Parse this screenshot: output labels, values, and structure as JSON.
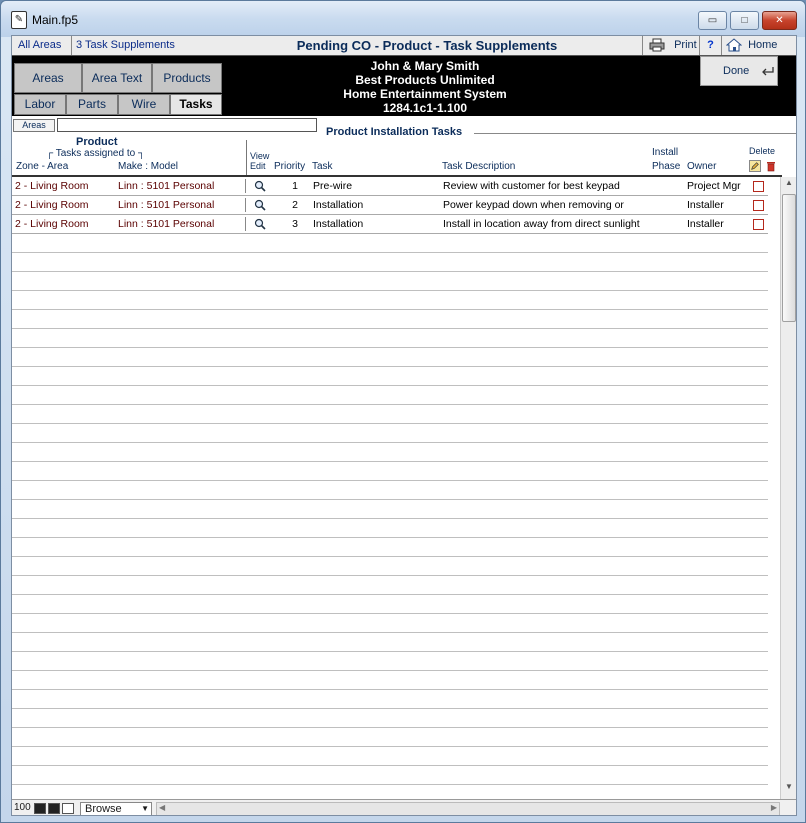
{
  "window": {
    "title": "Main.fp5",
    "minimize": "▭",
    "maximize": "□",
    "close": "✕"
  },
  "toolbar": {
    "all_areas": "All Areas",
    "supplements_count": "3  Task Supplements",
    "page_title": "Pending CO - Product - Task Supplements",
    "print_label": "Print",
    "help_label": "?",
    "home_label": "Home"
  },
  "header": {
    "client_name": "John & Mary Smith",
    "company": "Best Products Unlimited",
    "system": "Home Entertainment System",
    "job_number": "1284.1c1-1.100",
    "done_label": "Done"
  },
  "tabs": {
    "top": [
      {
        "label": "Areas",
        "active": false
      },
      {
        "label": "Area Text",
        "active": false
      },
      {
        "label": "Products",
        "active": false
      }
    ],
    "bottom": [
      {
        "label": "Labor",
        "active": false
      },
      {
        "label": "Parts",
        "active": false
      },
      {
        "label": "Wire",
        "active": false
      },
      {
        "label": "Tasks",
        "active": true
      }
    ]
  },
  "filter": {
    "areas_label": "Areas",
    "areas_value": "",
    "section_title": "Product Installation Tasks"
  },
  "columns": {
    "product": "Product",
    "tasks_assigned": "Tasks assigned to",
    "zone_area": "Zone - Area",
    "make_model": "Make : Model",
    "view": "View",
    "edit": "Edit",
    "priority": "Priority",
    "task": "Task",
    "task_description": "Task Description",
    "install": "Install",
    "phase": "Phase",
    "owner": "Owner",
    "delete": "Delete"
  },
  "rows": [
    {
      "zone": "2 - Living Room",
      "model": "Linn : 5101 Personal",
      "priority": "1",
      "task": "Pre-wire",
      "description": "Review with customer for best keypad",
      "owner": "Project Mgr"
    },
    {
      "zone": "2 - Living Room",
      "model": "Linn : 5101 Personal",
      "priority": "2",
      "task": "Installation",
      "description": "Power keypad down when removing or",
      "owner": "Installer"
    },
    {
      "zone": "2 - Living Room",
      "model": "Linn : 5101 Personal",
      "priority": "3",
      "task": "Installation",
      "description": "Install in location away from direct sunlight",
      "owner": "Installer"
    }
  ],
  "statusbar": {
    "zoom": "100",
    "mode": "Browse"
  },
  "colors": {
    "accent": "#0b2c5a",
    "header_band": "#000000",
    "delete_red": "#b4281c"
  }
}
